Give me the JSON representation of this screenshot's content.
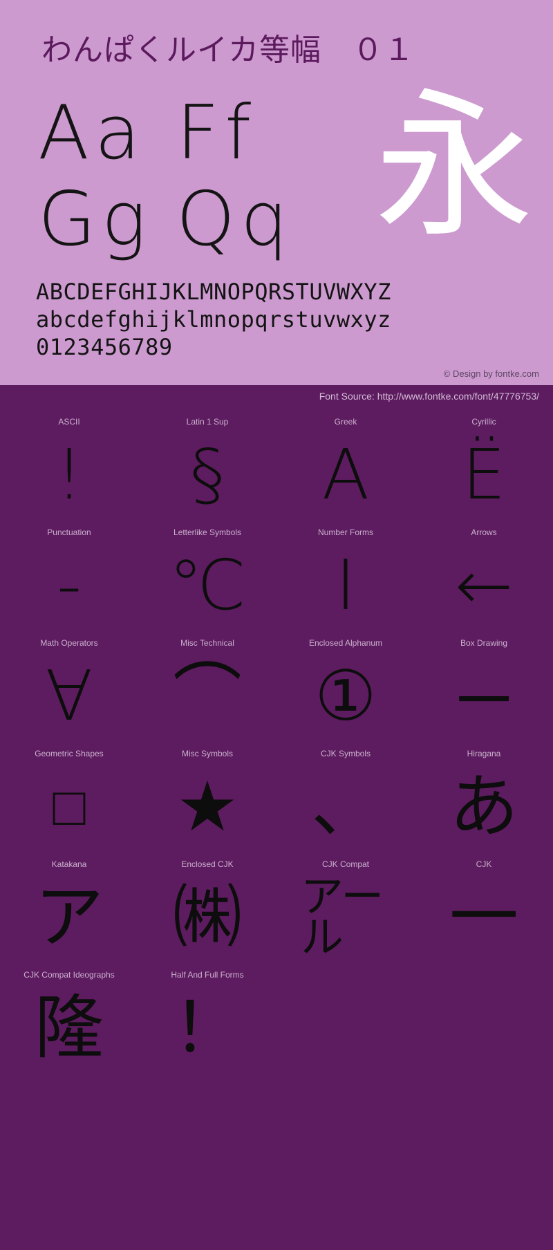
{
  "specimen": {
    "title": "わんぱくルイカ等幅　０１",
    "background_color": "#cd9ad0",
    "sample_rows": [
      {
        "left": "Aa",
        "right": "Ff"
      },
      {
        "left": "Gg",
        "right": "Qq"
      }
    ],
    "feature_glyph": "永",
    "feature_glyph_color": "#ffffff",
    "uppercase": "ABCDEFGHIJKLMNOPQRSTUVWXYZ",
    "lowercase": "abcdefghijklmnopqrstuvwxyz",
    "digits": "0123456789",
    "copyright": "© Design by fontke.com"
  },
  "source": {
    "text": "Font Source: http://www.fontke.com/font/47776753/",
    "background_color": "#5d1c5f",
    "text_color": "#d4bcd8"
  },
  "blocks": {
    "background_color": "#5d1c5f",
    "label_color": "#cbb0cf",
    "glyph_color": "#0d0d0d",
    "rows": [
      [
        {
          "label": "ASCII",
          "glyph": "!",
          "size": "large"
        },
        {
          "label": "Latin 1 Sup",
          "glyph": "§",
          "size": "large"
        },
        {
          "label": "Greek",
          "glyph": "Α",
          "size": "large"
        },
        {
          "label": "Cyrillic",
          "glyph": "Ё",
          "size": "large"
        }
      ],
      [
        {
          "label": "Punctuation",
          "glyph": "‐",
          "size": "large"
        },
        {
          "label": "Letterlike Symbols",
          "glyph": "℃",
          "size": "large"
        },
        {
          "label": "Number Forms",
          "glyph": "Ⅰ",
          "size": "large"
        },
        {
          "label": "Arrows",
          "glyph": "←",
          "size": "large"
        }
      ],
      [
        {
          "label": "Math Operators",
          "glyph": "∀",
          "size": "large"
        },
        {
          "label": "Misc Technical",
          "glyph": "⌒",
          "size": "large"
        },
        {
          "label": "Enclosed Alphanum",
          "glyph": "①",
          "size": "large"
        },
        {
          "label": "Box Drawing",
          "glyph": "─",
          "size": "large"
        }
      ],
      [
        {
          "label": "Geometric Shapes",
          "glyph": "□",
          "size": "medium"
        },
        {
          "label": "Misc Symbols",
          "glyph": "★",
          "size": "large"
        },
        {
          "label": "CJK Symbols",
          "glyph": "、",
          "size": "large"
        },
        {
          "label": "Hiragana",
          "glyph": "あ",
          "size": "large"
        }
      ],
      [
        {
          "label": "Katakana",
          "glyph": "ア",
          "size": "large"
        },
        {
          "label": "Enclosed CJK",
          "glyph": "㈱",
          "size": "large"
        },
        {
          "label": "CJK Compat",
          "glyph": "アール",
          "size": "wrap2"
        },
        {
          "label": "CJK",
          "glyph": "一",
          "size": "large"
        }
      ],
      [
        {
          "label": "CJK Compat Ideographs",
          "glyph": "隆",
          "size": "large"
        },
        {
          "label": "Half And Full Forms",
          "glyph": "！",
          "size": "large"
        }
      ]
    ]
  }
}
